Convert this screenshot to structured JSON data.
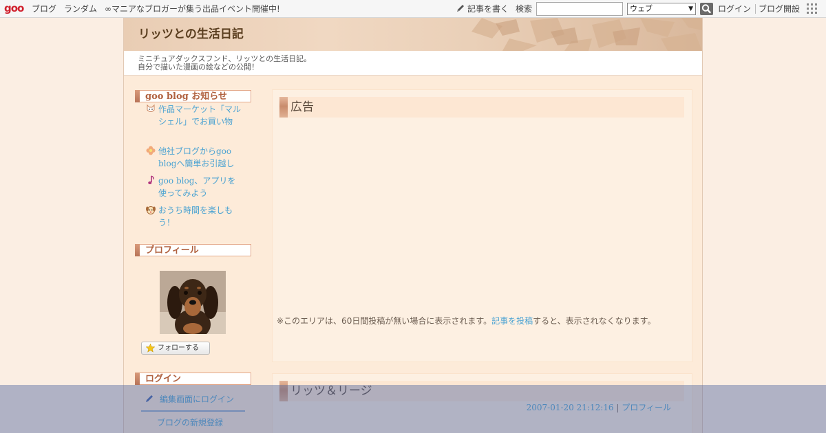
{
  "topbar": {
    "logo": "goo",
    "nav": [
      "ブログ",
      "ランダム",
      "∞マニアなブロガーが集う出品イベント開催中!"
    ],
    "write_label": "記事を書く",
    "search_label": "検索",
    "search_placeholder": "",
    "search_scope": "ウェブ",
    "login_label": "ログイン",
    "create_blog_label": "ブログ開設"
  },
  "blog": {
    "title": "リッツとの生活日記",
    "description_lines": [
      "ミニチュアダックスフンド、リッツとの生活日記。",
      "自分で描いた漫画の絵などの公開！"
    ]
  },
  "sidebar": {
    "notice_heading": "goo blog お知らせ",
    "notices": [
      {
        "icon": "cat-icon",
        "text": "作品マーケット「マルシェル」でお買い物"
      },
      {
        "icon": "flower-icon",
        "text": "他社ブログからgoo blogへ簡単お引越し"
      },
      {
        "icon": "music-note-icon",
        "text": "goo blog、アプリを使ってみよう"
      },
      {
        "icon": "dog-icon",
        "text": "おうち時間を楽しもう！"
      }
    ],
    "profile_heading": "プロフィール",
    "follow_label": "フォローする",
    "login_heading": "ログイン",
    "login_link": "編集画面にログイン",
    "register_link": "ブログの新規登録"
  },
  "ad_panel": {
    "heading": "広告",
    "note_prefix": "※このエリアは、60日間投稿が無い場合に表示されます。",
    "note_link": "記事を投稿",
    "note_suffix": "すると、表示されなくなります。"
  },
  "post": {
    "title": "リッツ＆リージ",
    "datetime": "2007-01-20 21:12:16",
    "separator": "|",
    "category": "プロフィール"
  },
  "colors": {
    "page_bg": "#fbeee3",
    "link": "#4aa2d2",
    "heading_accent": "#b0613f",
    "overlay": "#5469a0"
  }
}
